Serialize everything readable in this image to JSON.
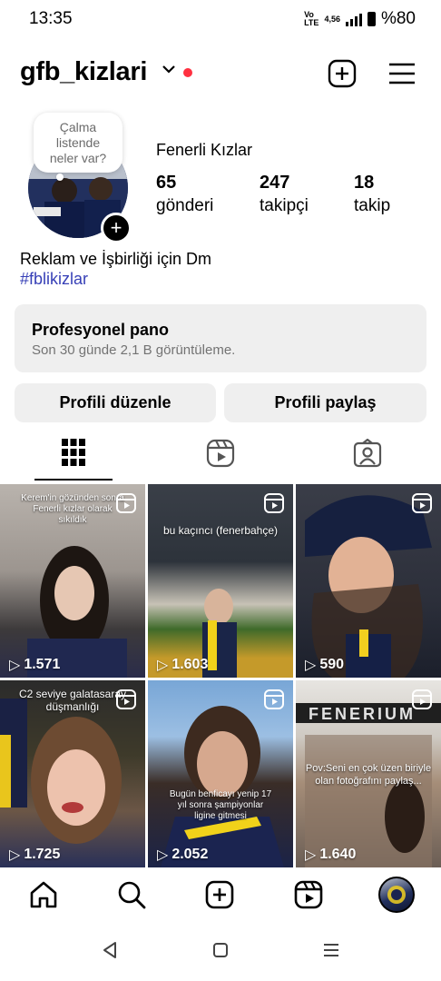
{
  "status_bar": {
    "time": "13:35",
    "network_label": "4,56",
    "battery": "%80"
  },
  "header": {
    "username": "gfb_kizlari"
  },
  "profile": {
    "note_bubble": [
      "Çalma",
      "listende",
      "neler var?"
    ],
    "full_name": "Fenerli Kızlar",
    "stats": [
      {
        "value": "65",
        "label": "gönderi"
      },
      {
        "value": "247",
        "label": "takipçi"
      },
      {
        "value": "18",
        "label": "takip"
      }
    ],
    "bio": "Reklam ve İşbirliği için Dm",
    "hashtag": "#fblikizlar"
  },
  "pro_dashboard": {
    "title": "Profesyonel pano",
    "subtitle": "Son 30 günde 2,1 B görüntüleme."
  },
  "buttons": {
    "edit": "Profili düzenle",
    "share": "Profili paylaş"
  },
  "tabs": [
    "grid-icon",
    "reels-icon",
    "tagged-icon"
  ],
  "grid": [
    {
      "caption": "Kerem'in gözünden sonra Fenerli kızlar olarak sıkıldık",
      "views": "1.571"
    },
    {
      "caption": "bu kaçıncı (fenerbahçe)",
      "views": "1.603"
    },
    {
      "caption": "",
      "views": "590"
    },
    {
      "caption": "C2 seviye galatasaray düşmanlığı",
      "views": "1.725"
    },
    {
      "caption": "Bugün benficayı yenip 17 yıl sonra şampiyonlar ligine gitmesi",
      "views": "2.052"
    },
    {
      "caption": "Pov:Seni en çok üzen biriyle olan fotoğrafını paylaş...",
      "views": "1.640"
    }
  ],
  "bottom_nav": [
    "home-icon",
    "search-icon",
    "create-icon",
    "reels-icon",
    "profile-avatar"
  ],
  "colors": {
    "accent_link": "#3740b7",
    "notification_dot": "#ff3040",
    "panel_bg": "#efefef"
  }
}
